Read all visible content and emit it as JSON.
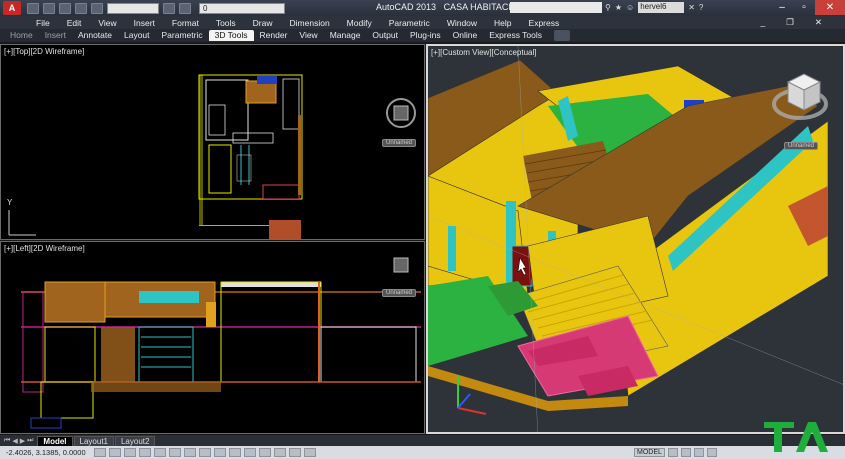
{
  "app": {
    "title": "AutoCAD 2013",
    "document": "CASA HABITACION.dwg",
    "workspace": "",
    "layer_value": "0",
    "search_placeholder": "",
    "user": "hervel6",
    "colors": {
      "accent": "#c62828",
      "titlebar": "#2d333d",
      "viewport_bg": "#000000",
      "viewport3d_bg": "#2d3339"
    }
  },
  "menu": {
    "items": [
      "File",
      "Edit",
      "View",
      "Insert",
      "Format",
      "Tools",
      "Draw",
      "Dimension",
      "Modify",
      "Parametric",
      "Window",
      "Help",
      "Express"
    ]
  },
  "ribbon": {
    "tabs": [
      "Home",
      "Insert",
      "Annotate",
      "Layout",
      "Parametric",
      "3D Tools",
      "Render",
      "View",
      "Manage",
      "Output",
      "Plug-ins",
      "Online",
      "Express Tools"
    ],
    "active_tab": "3D Tools"
  },
  "viewports": {
    "top_label": "[+][Top][2D Wireframe]",
    "left_label": "[+][Left][2D Wireframe]",
    "custom_label": "[+][Custom View][Conceptual]",
    "unnamed": "Unnamed",
    "viewcube_top": "TOP",
    "viewcube_front": "FRONT",
    "viewcube_right": "RIGHT",
    "ucs_y": "Y"
  },
  "layout_tabs": {
    "tabs": [
      "Model",
      "Layout1",
      "Layout2"
    ],
    "active": "Model"
  },
  "status": {
    "coordinates": "-2.4026, 3.1385, 0.0000",
    "model_label": "MODEL"
  }
}
